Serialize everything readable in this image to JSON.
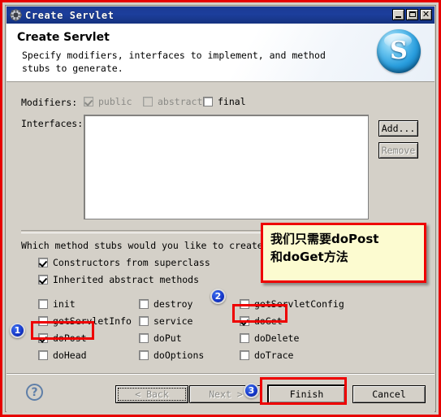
{
  "window": {
    "title": "Create Servlet",
    "icon": "gear-icon",
    "controls": {
      "minimize": "_",
      "maximize": "[]",
      "close": "✕"
    }
  },
  "banner": {
    "title": "Create Servlet",
    "description": "Specify modifiers, interfaces to implement, and method stubs to generate.",
    "logo_letter": "S",
    "logo_color": "#2a9ede"
  },
  "form": {
    "modifiers_label": "Modifiers:",
    "modifiers": [
      {
        "label": "public",
        "checked": true,
        "enabled": false
      },
      {
        "label": "abstract",
        "checked": false,
        "enabled": false
      },
      {
        "label": "final",
        "checked": false,
        "enabled": true
      }
    ],
    "interfaces_label": "Interfaces:",
    "interfaces_items": [],
    "add_button": "Add...",
    "remove_button": "Remove"
  },
  "stubs": {
    "question": "Which method stubs would you like to create?",
    "top": [
      {
        "label": "Constructors from superclass",
        "checked": true
      },
      {
        "label": "Inherited abstract methods",
        "checked": true
      }
    ],
    "column1": [
      {
        "label": "init",
        "checked": false
      },
      {
        "label": "getServletInfo",
        "checked": false
      },
      {
        "label": "doPost",
        "checked": true
      },
      {
        "label": "doHead",
        "checked": false
      }
    ],
    "column2": [
      {
        "label": "destroy",
        "checked": false
      },
      {
        "label": "service",
        "checked": false
      },
      {
        "label": "doPut",
        "checked": false
      },
      {
        "label": "doOptions",
        "checked": false
      }
    ],
    "column3": [
      {
        "label": "getServletConfig",
        "checked": false
      },
      {
        "label": "doGet",
        "checked": true
      },
      {
        "label": "doDelete",
        "checked": false
      },
      {
        "label": "doTrace",
        "checked": false
      }
    ]
  },
  "footer": {
    "help": "?",
    "back": "< Back",
    "next": "Next >",
    "finish": "Finish",
    "cancel": "Cancel"
  },
  "annotations": {
    "highlight_color": "#ee0000",
    "badge_color": "#1436c8",
    "badges": [
      {
        "number": "1",
        "target": "doPost"
      },
      {
        "number": "2",
        "target": "doGet"
      },
      {
        "number": "3",
        "target": "Finish"
      }
    ],
    "note": "我们只需要doPost\n和doGet方法"
  }
}
